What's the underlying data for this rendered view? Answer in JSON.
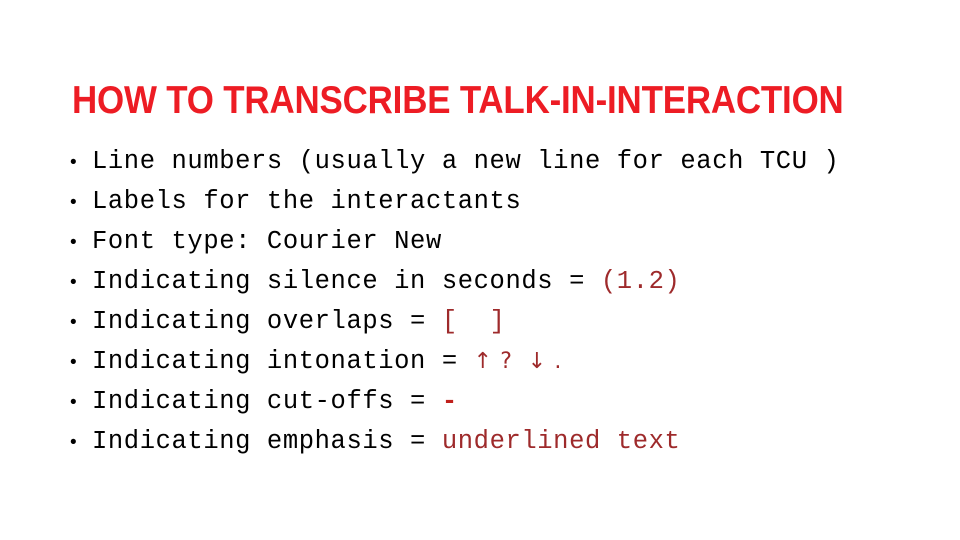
{
  "slide": {
    "title": "HOW TO TRANSCRIBE TALK-IN-INTERACTION",
    "title_color": "#ED1C24",
    "background_color": "#FFFFFF",
    "body_color": "#000000",
    "accent_color": "#9E2A2B",
    "bullet_glyph": "•"
  },
  "bullets": [
    {
      "id": "line-numbers",
      "segments": [
        {
          "text": "Line numbers (usually a new line for each TCU )",
          "style": "plain"
        }
      ]
    },
    {
      "id": "labels",
      "segments": [
        {
          "text": "Labels for the interactants",
          "style": "plain"
        }
      ]
    },
    {
      "id": "font-type",
      "segments": [
        {
          "text": "Font type: Courier New",
          "style": "plain"
        }
      ]
    },
    {
      "id": "silence",
      "segments": [
        {
          "text": "Indicating silence in seconds = ",
          "style": "plain"
        },
        {
          "text": "(1.2)",
          "style": "red"
        }
      ]
    },
    {
      "id": "overlaps",
      "segments": [
        {
          "text": "Indicating overlaps = ",
          "style": "plain"
        },
        {
          "text": "[  ]",
          "style": "red"
        }
      ]
    },
    {
      "id": "intonation",
      "segments": [
        {
          "text": "Indicating intonation = ",
          "style": "plain"
        },
        {
          "text": "↑ ?  ↓ .",
          "style": "arrow"
        }
      ]
    },
    {
      "id": "cut-offs",
      "segments": [
        {
          "text": "Indicating cut-offs = ",
          "style": "plain"
        },
        {
          "text": "-",
          "style": "dash"
        }
      ]
    },
    {
      "id": "emphasis",
      "segments": [
        {
          "text": "Indicating emphasis = ",
          "style": "plain"
        },
        {
          "text": "underlined text",
          "style": "red"
        }
      ]
    }
  ]
}
